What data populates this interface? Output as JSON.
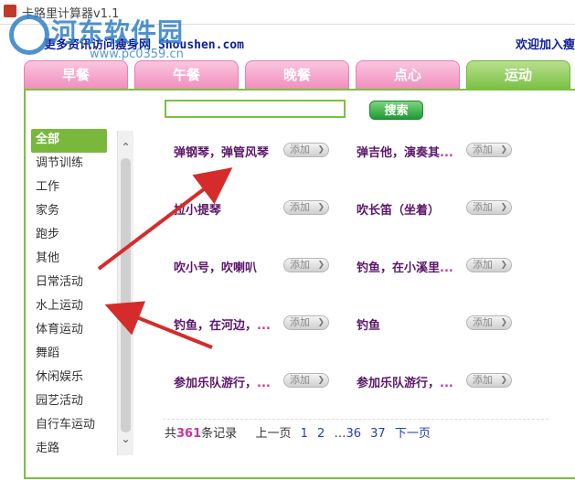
{
  "window": {
    "title": "卡路里计算器v1.1"
  },
  "watermark": {
    "brand": "河东软件园",
    "url": "www.pc0359.cn"
  },
  "header": {
    "info_prefix": "更多资讯访问瘦身网",
    "site": "Shoushen.com",
    "welcome": "欢迎加入瘦"
  },
  "tabs": [
    {
      "label": "早餐"
    },
    {
      "label": "午餐"
    },
    {
      "label": "晚餐"
    },
    {
      "label": "点心"
    },
    {
      "label": "运动",
      "active": true
    }
  ],
  "search": {
    "value": "",
    "button_label": "搜索"
  },
  "categories": [
    "全部",
    "调节训练",
    "工作",
    "家务",
    "跑步",
    "其他",
    "日常活动",
    "水上运动",
    "体育运动",
    "舞蹈",
    "休闲娱乐",
    "园艺活动",
    "自行车运动",
    "走路"
  ],
  "add_label": "添加",
  "activities": [
    {
      "name": "弹钢琴，弹管风琴",
      "dots": ""
    },
    {
      "name": "弹吉他，演奏其",
      "dots": "..."
    },
    {
      "name": "拉小提琴",
      "dots": ""
    },
    {
      "name": "吹长笛（坐着）",
      "dots": ""
    },
    {
      "name": "吹小号，吹喇叭",
      "dots": ""
    },
    {
      "name": "钓鱼，在小溪里",
      "dots": "..."
    },
    {
      "name": "钓鱼，在河边，",
      "dots": "..."
    },
    {
      "name": "钓鱼",
      "dots": ""
    },
    {
      "name": "参加乐队游行，",
      "dots": "..."
    },
    {
      "name": "参加乐队游行，",
      "dots": "..."
    }
  ],
  "pager": {
    "prefix": "共",
    "count": "361",
    "suffix": "条记录",
    "prev": "上一页",
    "p1": "1",
    "p2": "2",
    "ellipsis": "…",
    "p36": "36",
    "p37": "37",
    "next": "下一页"
  },
  "colors": {
    "accent_green": "#7bc043",
    "tab_pink": "#f28dbd",
    "arrow_red": "#d62b2b"
  }
}
